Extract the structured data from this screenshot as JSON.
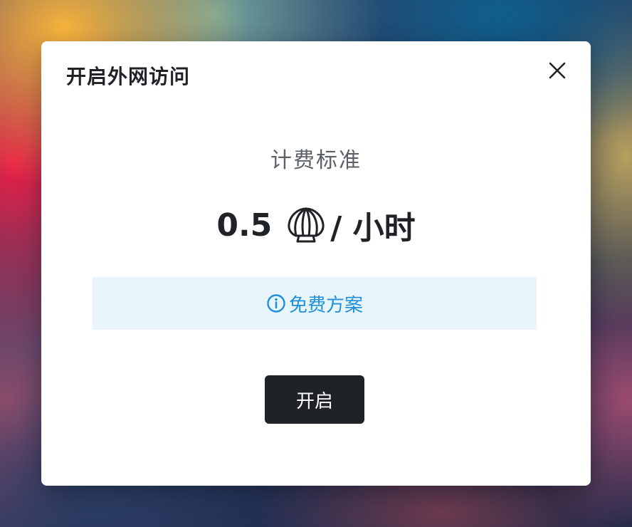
{
  "dialog": {
    "title": "开启外网访问",
    "pricing_label": "计费标准",
    "price": {
      "value": "0.5",
      "currency_icon": "shell-icon",
      "unit": "/ 小时"
    },
    "free_plan_label": "免费方案",
    "enable_button_label": "开启",
    "close_icon": "close-icon"
  },
  "colors": {
    "info_text": "#1f8fd8",
    "info_background": "#e8f5fd",
    "button_background": "#1f2226",
    "title_text": "#1f2226"
  }
}
